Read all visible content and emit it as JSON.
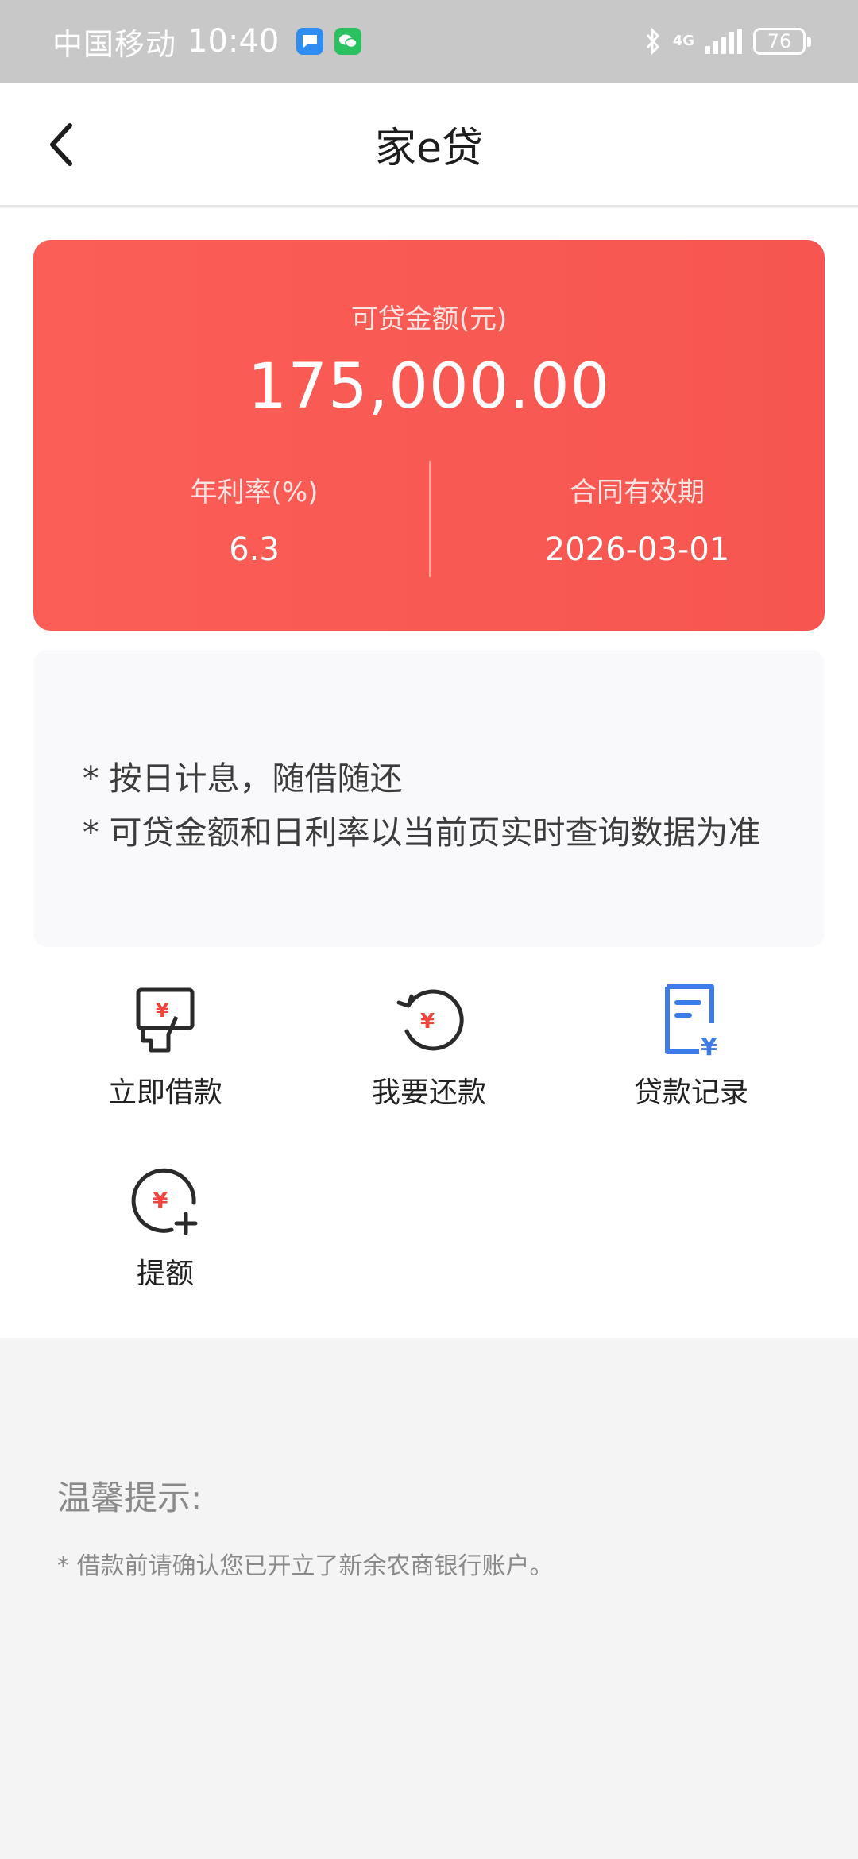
{
  "status_bar": {
    "carrier": "中国移动",
    "time": "10:40",
    "network": "4G",
    "battery": "76"
  },
  "nav": {
    "title": "家e贷"
  },
  "loan_card": {
    "amount_label": "可贷金额(元)",
    "amount": "175,000.00",
    "rate_label": "年利率(%)",
    "rate_value": "6.3",
    "validity_label": "合同有效期",
    "validity_value": "2026-03-01"
  },
  "notice": {
    "line1": "* 按日计息，随借随还",
    "line2": "* 可贷金额和日利率以当前页实时查询数据为准"
  },
  "actions": [
    {
      "label": "立即借款",
      "icon": "borrow-hand-card-icon"
    },
    {
      "label": "我要还款",
      "icon": "repay-circle-arrow-icon"
    },
    {
      "label": "贷款记录",
      "icon": "loan-record-document-icon"
    },
    {
      "label": "提额",
      "icon": "raise-limit-plus-icon"
    }
  ],
  "tips": {
    "title": "温馨提示:",
    "text": "* 借款前请确认您已开立了新余农商银行账户。"
  },
  "colors": {
    "card_red": "#f85a53",
    "icon_red": "#f0453d",
    "icon_blue": "#3d7bea",
    "status_bar_bg": "#c8c8c8"
  }
}
